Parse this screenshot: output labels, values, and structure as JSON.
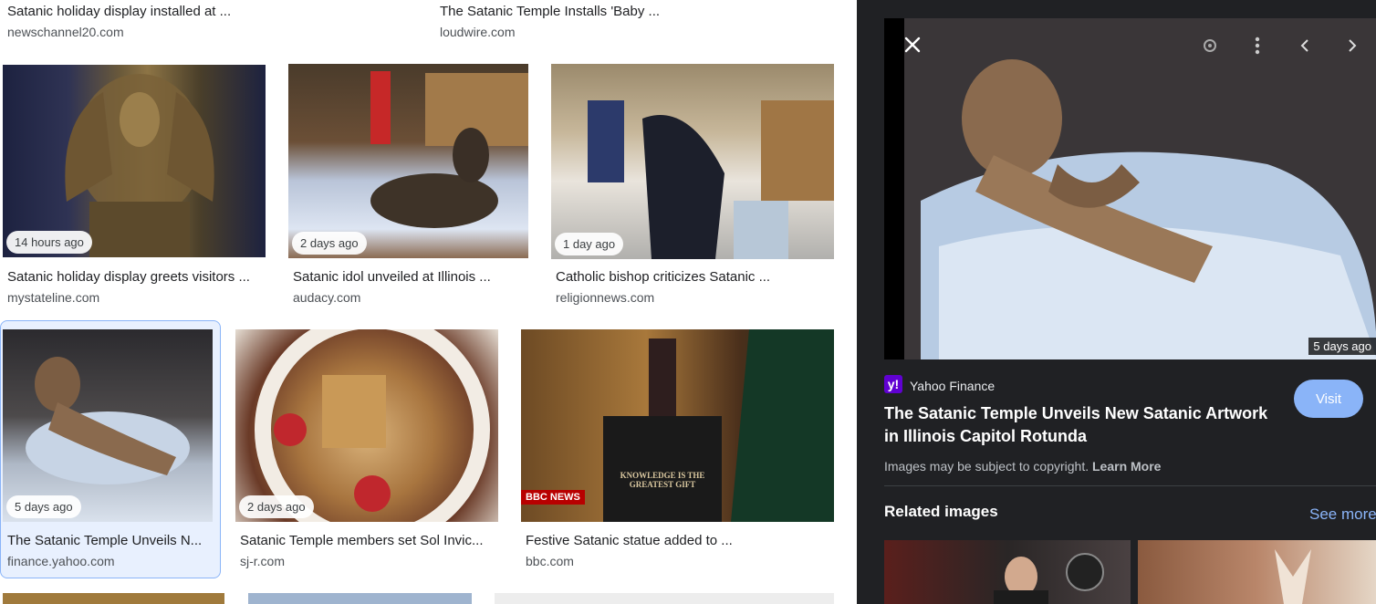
{
  "top_row": [
    {
      "title": "Satanic holiday display installed at ...",
      "source": "newschannel20.com"
    },
    {
      "title": "The Satanic Temple Installs 'Baby ...",
      "source": "loudwire.com"
    }
  ],
  "row1": [
    {
      "badge": "14 hours ago",
      "title": "Satanic holiday display greets visitors ...",
      "source": "mystateline.com"
    },
    {
      "badge": "2 days ago",
      "title": "Satanic idol unveiled at Illinois ...",
      "source": "audacy.com"
    },
    {
      "badge": "1 day ago",
      "title": "Catholic bishop criticizes Satanic ...",
      "source": "religionnews.com"
    }
  ],
  "row2": [
    {
      "badge": "5 days ago",
      "title": "The Satanic Temple Unveils N...",
      "source": "finance.yahoo.com"
    },
    {
      "badge": "2 days ago",
      "title": "Satanic Temple members set Sol Invic...",
      "source": "sj-r.com"
    },
    {
      "badge": "",
      "title": "Festive Satanic statue added to ...",
      "source": "bbc.com"
    }
  ],
  "thumb_text": {
    "bbc_logo": "BBC NEWS",
    "plaque": "KNOWLEDGE IS THE GREATEST GIFT"
  },
  "panel": {
    "age": "5 days ago",
    "source_logo": "y!",
    "source_name": "Yahoo Finance",
    "title": "The Satanic Temple Unveils New Satanic Artwork in Illinois Capitol Rotunda",
    "visit_label": "Visit",
    "copyright_text": "Images may be subject to copyright.",
    "learn_more": "Learn More",
    "related_heading": "Related images",
    "see_more": "See more"
  },
  "colors": {
    "panel_bg": "#202124",
    "accent": "#8ab4f8",
    "yahoo_purple": "#6001d2",
    "selected_bg": "#e8f0fe"
  }
}
